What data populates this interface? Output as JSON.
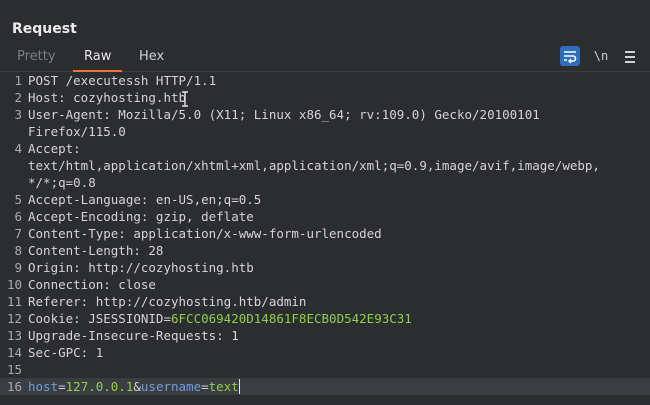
{
  "panel": {
    "title": "Request"
  },
  "tabs": [
    {
      "label": "Pretty",
      "state": "inactive"
    },
    {
      "label": "Raw",
      "state": "active"
    },
    {
      "label": "Hex",
      "state": "normal"
    }
  ],
  "toolbar": {
    "newline_label": "\\n"
  },
  "lines": [
    {
      "no": "1",
      "text": "POST /executessh HTTP/1.1"
    },
    {
      "no": "2",
      "text": "Host: cozyhosting.htb"
    },
    {
      "no": "3",
      "text": "User-Agent: Mozilla/5.0 (X11; Linux x86_64; rv:109.0) Gecko/20100101",
      "wrap": "Firefox/115.0"
    },
    {
      "no": "4",
      "text": "Accept:",
      "wrap": "text/html,application/xhtml+xml,application/xml;q=0.9,image/avif,image/webp,",
      "wrap2": "*/*;q=0.8"
    },
    {
      "no": "5",
      "text": "Accept-Language: en-US,en;q=0.5"
    },
    {
      "no": "6",
      "text": "Accept-Encoding: gzip, deflate"
    },
    {
      "no": "7",
      "text": "Content-Type: application/x-www-form-urlencoded"
    },
    {
      "no": "8",
      "text": "Content-Length: 28"
    },
    {
      "no": "9",
      "text": "Origin: http://cozyhosting.htb"
    },
    {
      "no": "10",
      "text": "Connection: close"
    },
    {
      "no": "11",
      "text": "Referer: http://cozyhosting.htb/admin"
    },
    {
      "no": "12",
      "key": "Cookie: JSESSIONID=",
      "cookie": "6FCC069420D14861F8ECB0D542E93C31"
    },
    {
      "no": "13",
      "text": "Upgrade-Insecure-Requests: 1"
    },
    {
      "no": "14",
      "text": "Sec-GPC: 1"
    },
    {
      "no": "15",
      "text": ""
    },
    {
      "no": "16",
      "body": {
        "k1": "host",
        "eq1": "=",
        "v1": "127.0.0.1",
        "amp": "&",
        "k2": "username",
        "eq2": "=",
        "v2": "text"
      }
    }
  ],
  "colors": {
    "accent": "#e8743b",
    "param_value": "#8fcf4a",
    "param_key": "#6f9fd9",
    "wrap_button": "#2f6fba"
  }
}
